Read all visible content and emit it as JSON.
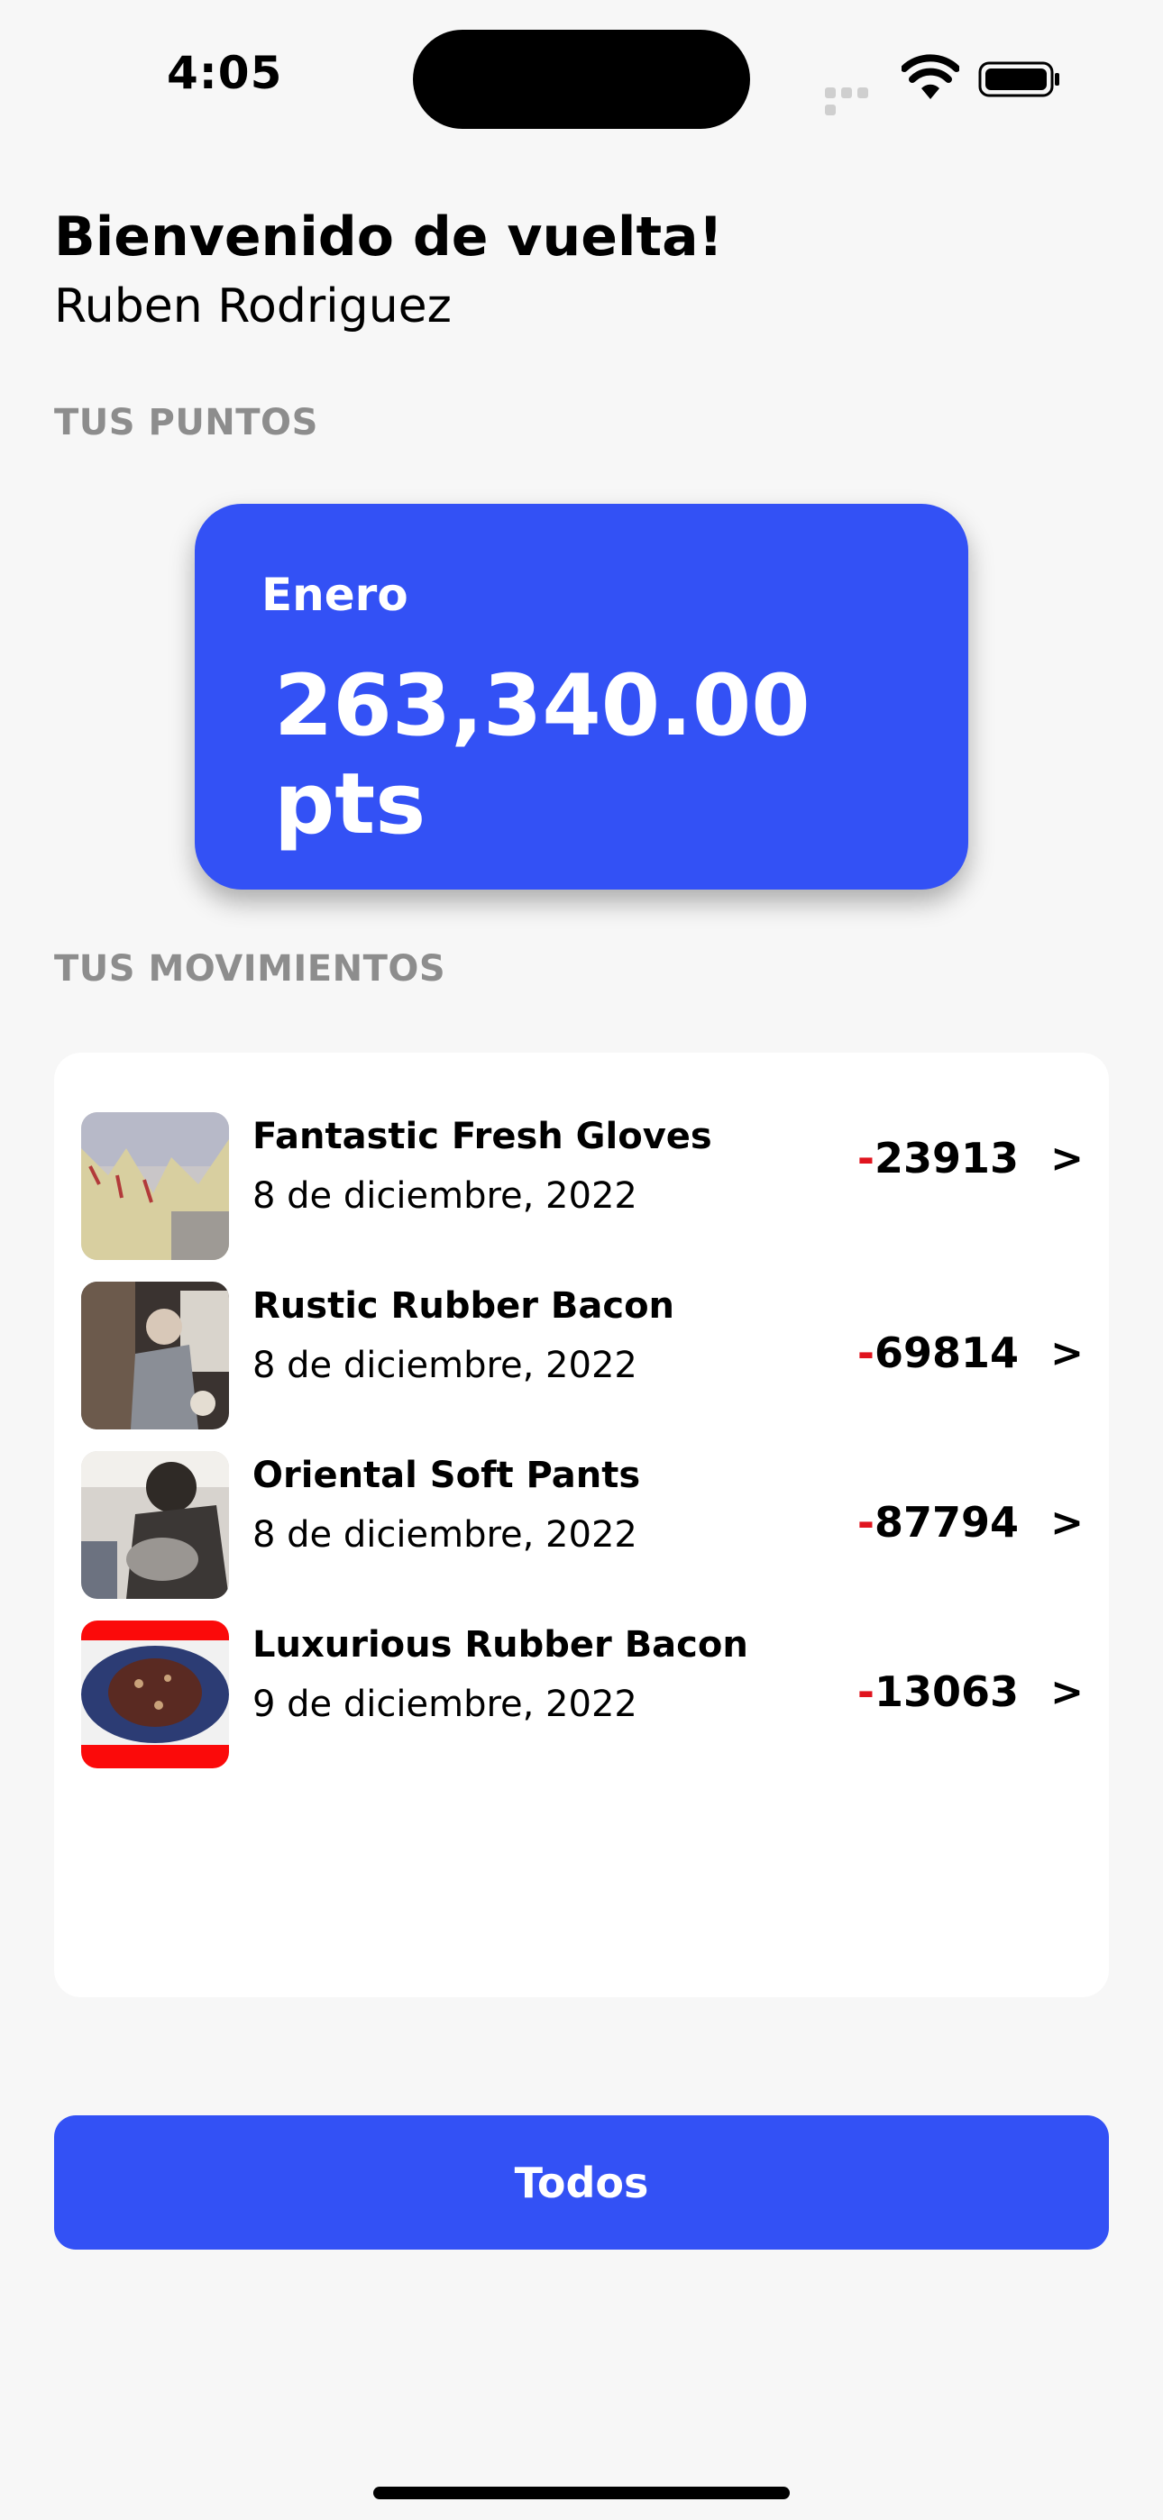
{
  "status_bar": {
    "time": "4:05"
  },
  "header": {
    "welcome": "Bienvenido de vuelta!",
    "user_name": "Ruben Rodriguez"
  },
  "points": {
    "section_label": "TUS PUNTOS",
    "month": "Enero",
    "value": "263,340.00 pts"
  },
  "movements": {
    "section_label": "TUS MOVIMIENTOS",
    "items": [
      {
        "title": "Fantastic Fresh Gloves",
        "date": "8 de diciembre, 2022",
        "sign": "-",
        "amount": "23913",
        "chevron": ">"
      },
      {
        "title": "Rustic Rubber Bacon",
        "date": "8 de diciembre, 2022",
        "sign": "-",
        "amount": "69814",
        "chevron": ">"
      },
      {
        "title": "Oriental Soft Pants",
        "date": "8 de diciembre, 2022",
        "sign": "-",
        "amount": "87794",
        "chevron": ">"
      },
      {
        "title": "Luxurious Rubber Bacon",
        "date": "9 de diciembre, 2022",
        "sign": "-",
        "amount": "13063",
        "chevron": ">"
      }
    ]
  },
  "actions": {
    "all_label": "Todos"
  },
  "colors": {
    "accent": "#3351f5",
    "negative": "#e0141e",
    "background": "#f7f7f7",
    "muted_label": "#8d8d8d"
  }
}
